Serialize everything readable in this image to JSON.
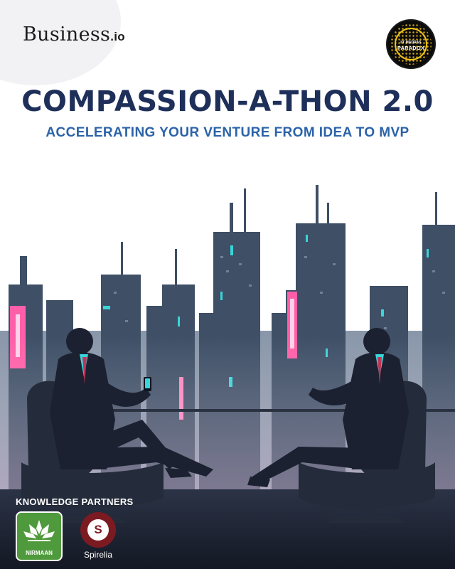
{
  "brand": {
    "name_main": "Business",
    "name_suffix": ".io"
  },
  "sponsor_badge": {
    "top_text": "IIT MADRAS",
    "main_text": "PARADOX",
    "colors": {
      "background": "#0b0b0b",
      "accent": "#f2c21a"
    }
  },
  "hero": {
    "title": "COMPASSION-A-THON 2.0",
    "subtitle": "ACCELERATING YOUR VENTURE FROM IDEA TO MVP"
  },
  "partners": {
    "heading": "KNOWLEDGE PARTNERS",
    "items": [
      {
        "label": "NIRMAAN",
        "icon": "lotus-icon",
        "color": "#4f9a3c"
      },
      {
        "label": "Spirelia",
        "icon": "spiral-s-icon",
        "color": "#7c1a22"
      }
    ]
  },
  "colors": {
    "title": "#1e2f5a",
    "subtitle": "#2b63a8",
    "skyline": "#3e4f66",
    "neon_cyan": "#39d5d9",
    "neon_pink": "#ff5fa8"
  }
}
